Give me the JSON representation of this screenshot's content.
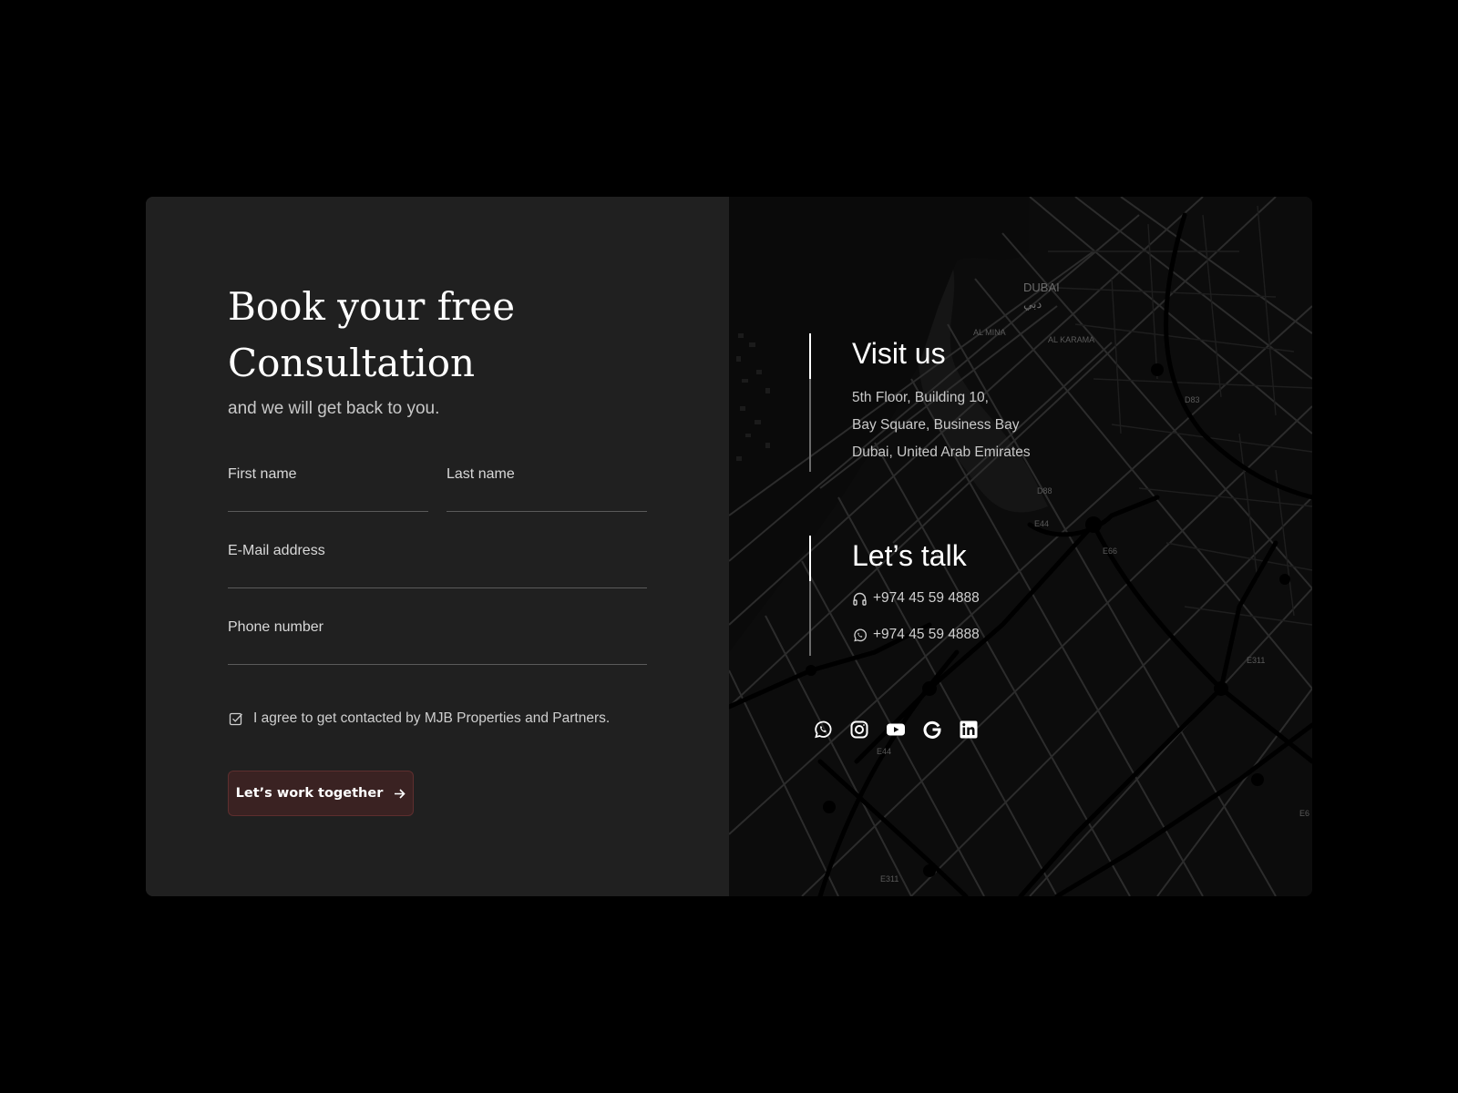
{
  "form": {
    "heading_line1": "Book your free",
    "heading_line2": "Consultation",
    "subheading": "and we will get back to you.",
    "first_name_label": "First name",
    "last_name_label": "Last name",
    "email_label": "E-Mail address",
    "phone_label": "Phone number",
    "consent_text": "I agree to get contacted by MJB Properties and Partners.",
    "consent_checked": true,
    "submit_label": "Let’s work together"
  },
  "contact": {
    "visit_title": "Visit us",
    "address": [
      "5th Floor, Building 10,",
      "Bay Square, Business Bay",
      "Dubai, United Arab Emirates"
    ],
    "talk_title": "Let’s talk",
    "phone": "+974 45 59 4888",
    "whatsapp": "+974 45 59 4888"
  },
  "map": {
    "labels": [
      "DUBAI",
      "دبي",
      "AL MINA",
      "AL KARAMA",
      "D83",
      "D88",
      "E44",
      "E66",
      "E311",
      "E44",
      "E311",
      "E6"
    ]
  },
  "socials": [
    {
      "icon": "whatsapp-icon"
    },
    {
      "icon": "instagram-icon"
    },
    {
      "icon": "youtube-icon"
    },
    {
      "icon": "google-icon"
    },
    {
      "icon": "linkedin-icon"
    }
  ],
  "colors": {
    "page_bg": "#000000",
    "card_left_bg": "#202020",
    "map_bg": "#0c0c0c",
    "button_bg": "#3a2222",
    "button_border": "#5e2e2e"
  }
}
